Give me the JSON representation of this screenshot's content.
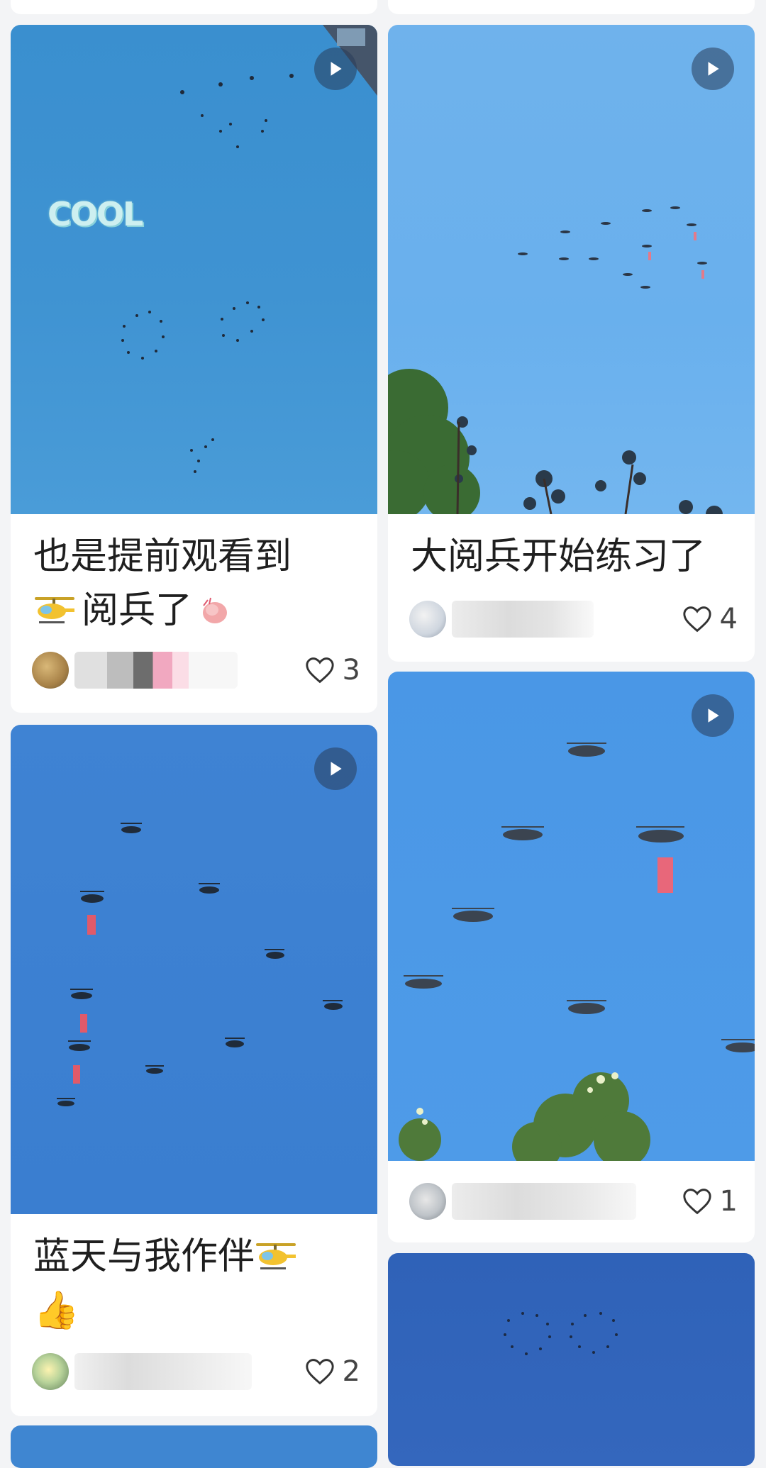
{
  "feed": {
    "cards": [
      {
        "title_line1": "也是提前观看到",
        "title_line2": "阅兵了",
        "sticker_text": "COOL",
        "username": "user",
        "likes": "3",
        "has_video": true
      },
      {
        "title_line1": "大阅兵开始练习了",
        "username": "user",
        "likes": "4",
        "has_video": true
      },
      {
        "title_line1": "蓝天与我作伴",
        "title_line2": "👍",
        "username": "user",
        "likes": "2",
        "has_video": true
      },
      {
        "username": "user",
        "likes": "1",
        "has_video": true
      }
    ]
  },
  "icons": {
    "play": "play-icon",
    "heart": "heart-outline-icon",
    "helicopter": "helicopter-emoji-icon",
    "thumbs_up": "thumbs-up-emoji"
  },
  "colors": {
    "sky": "#4a97e6",
    "banner": "#e8677a",
    "text": "#1f1f1f"
  }
}
